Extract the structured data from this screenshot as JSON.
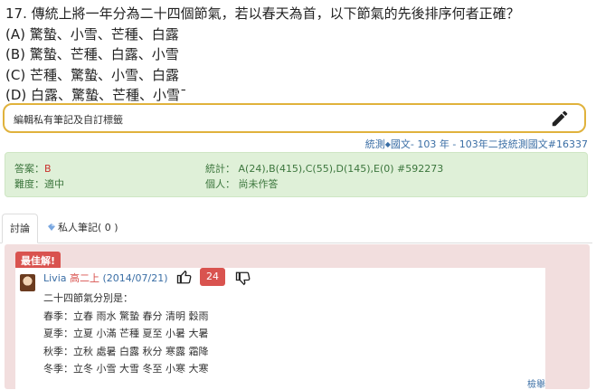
{
  "question": {
    "text": "17. 傳統上將一年分為二十四個節氣，若以春天為首，以下節氣的先後排序何者正確？",
    "options": [
      "(A) 驚蟄、小雪、芒種、白露",
      "(B) 驚蟄、芒種、白露、小雪",
      "(C) 芒種、驚蟄、小雪、白露",
      "(D) 白露、驚蟄、芒種、小雪ˉ"
    ]
  },
  "note": {
    "placeholder": "編輯私有筆記及自訂標籤",
    "icon": "pencil-icon"
  },
  "breadcrumb": {
    "part1": "統測",
    "part2": "國文- 103 年 - 103年二技統測國文#16337"
  },
  "stats": {
    "answer_label": "答案：",
    "answer_value": "B",
    "difficulty_label": "難度：",
    "difficulty_value": "適中",
    "stat_label": "統計：",
    "stat_value": "A(24),B(415),C(55),D(145),E(0) #592273",
    "personal_label": "個人：",
    "personal_value": "尚未作答"
  },
  "tabs": {
    "discussion": "討論",
    "private_notes": "私人筆記( 0 )"
  },
  "best_answer": {
    "badge": "最佳解!",
    "author": "Livia",
    "grade": "高二上",
    "date": "(2014/07/21)",
    "votes": "24",
    "lines": [
      "二十四節氣分別是：",
      "春季：立春 雨水 驚蟄 春分 清明 穀雨",
      "夏季：立夏 小滿 芒種 夏至 小暑 大暑",
      "秋季：立秋 處暑 白露 秋分 寒露 霜降",
      "冬季：立冬 小雪 大雪 冬至 小寒 大寒"
    ],
    "more": "檢舉"
  },
  "colors": {
    "accent": "#3a6ea5",
    "note_border": "#e0b23c",
    "success_bg": "#dff0d8",
    "danger": "#d9534f",
    "best_bg": "#f2dede"
  }
}
